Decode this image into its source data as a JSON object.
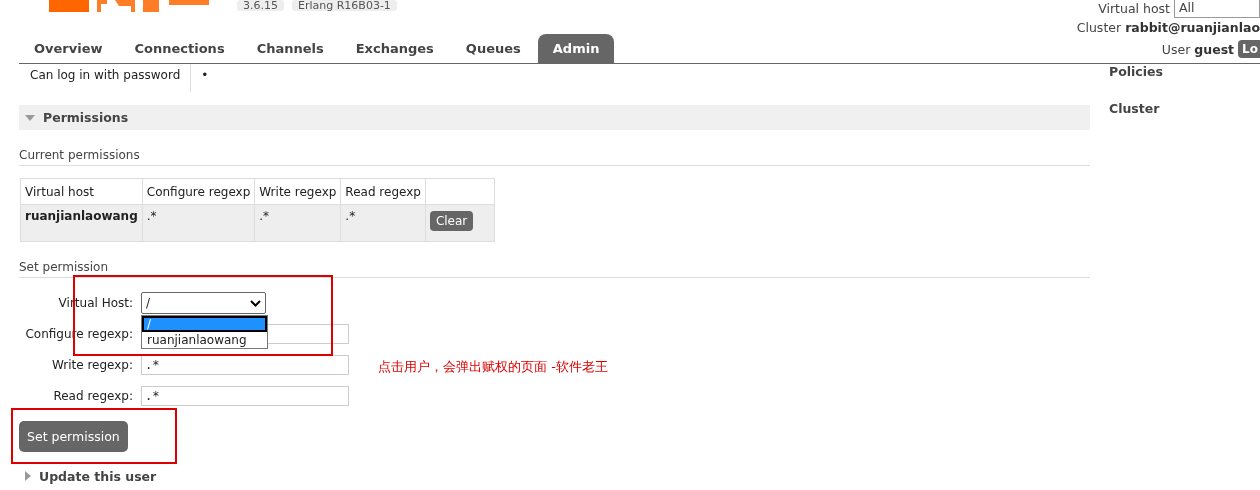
{
  "header": {
    "version": "3.6.15",
    "erlang": "Erlang R16B03-1",
    "virtual_host": {
      "label": "Virtual host",
      "value": "All"
    },
    "cluster": {
      "label": "Cluster",
      "value": "rabbit@ruanjianlao"
    },
    "user": {
      "label": "User",
      "value": "guest",
      "logout": "Lo"
    }
  },
  "tabs": [
    {
      "label": "Overview",
      "selected": false
    },
    {
      "label": "Connections",
      "selected": false
    },
    {
      "label": "Channels",
      "selected": false
    },
    {
      "label": "Exchanges",
      "selected": false
    },
    {
      "label": "Queues",
      "selected": false
    },
    {
      "label": "Admin",
      "selected": true
    }
  ],
  "user_props": [
    {
      "label": "Can log in with password",
      "value": "•"
    }
  ],
  "permissions": {
    "title": "Permissions",
    "expanded": true,
    "current_title": "Current permissions",
    "columns": [
      "Virtual host",
      "Configure regexp",
      "Write regexp",
      "Read regexp"
    ],
    "rows": [
      {
        "vhost": "ruanjianlaowang",
        "configure": ".*",
        "write": ".*",
        "read": ".*",
        "action": "Clear"
      }
    ]
  },
  "set_permission": {
    "title": "Set permission",
    "fields": [
      {
        "label": "Virtual Host:",
        "kind": "select",
        "value": "/",
        "open": true,
        "options": [
          {
            "label": "/",
            "selected": true
          },
          {
            "label": "ruanjianlaowang",
            "selected": false
          }
        ]
      },
      {
        "label": "Configure regexp:",
        "kind": "text"
      },
      {
        "label": "Write regexp:",
        "kind": "text",
        "value": ".*"
      },
      {
        "label": "Read regexp:",
        "kind": "text",
        "value": ".*"
      }
    ],
    "button": "Set permission"
  },
  "annotation": "点击用户，会弹出赋权的页面 -软件老王",
  "update_section": {
    "title": "Update this user",
    "expanded": false
  },
  "sidebar": {
    "items": [
      "Policies",
      "Cluster"
    ]
  }
}
